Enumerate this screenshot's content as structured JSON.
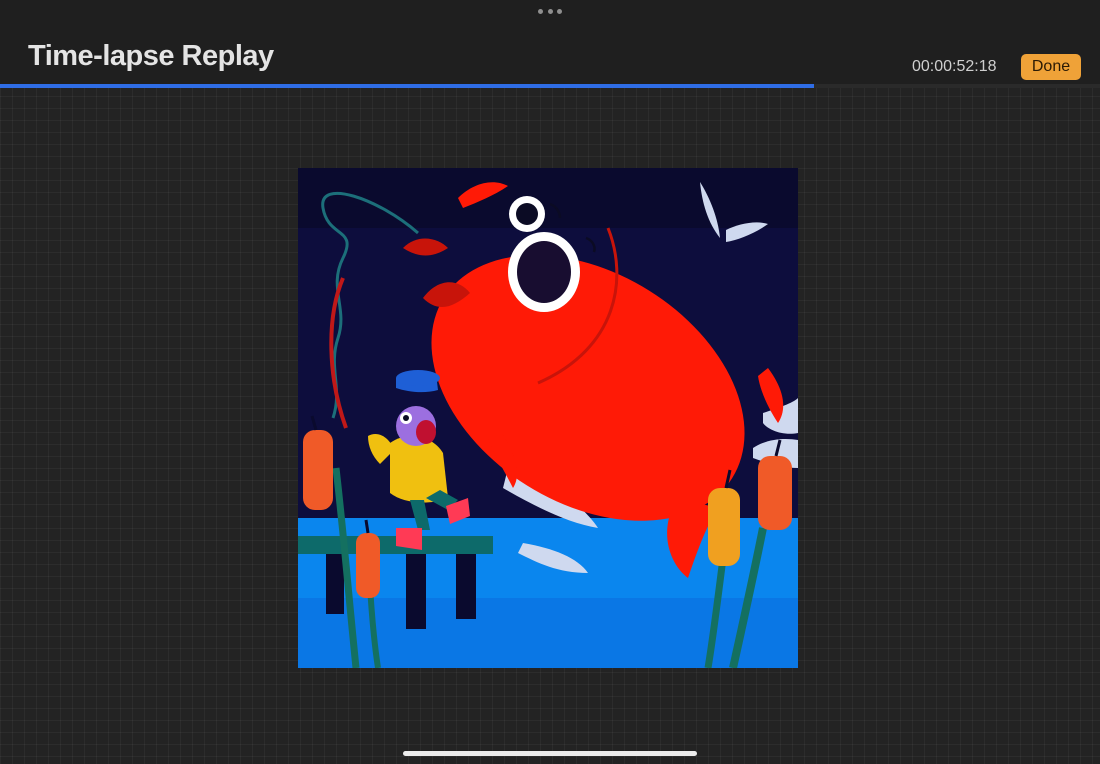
{
  "header": {
    "title": "Time-lapse Replay",
    "timecode": "00:00:52:18",
    "done_label": "Done"
  },
  "playback": {
    "progress": 0.74
  },
  "colors": {
    "accent_done": "#efa238",
    "progress_bar": "#2f6de6"
  },
  "icons": {
    "grabber": "more-dots-icon"
  }
}
